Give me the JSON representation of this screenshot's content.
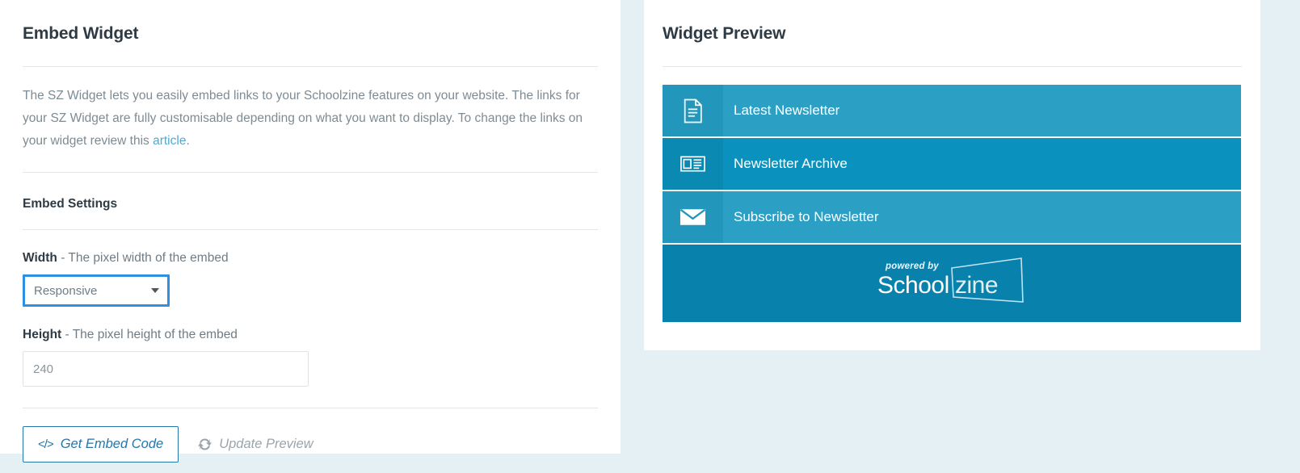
{
  "colors": {
    "page_background": "#e4f0f3",
    "card_background": "#ffffff",
    "heading": "#2f3b44",
    "body_text": "#7e8b93",
    "link": "#54a8ce",
    "focus_ring": "#2f8fe0",
    "button_outline": "#2576a8",
    "widget_row_light": "#2ba0c4",
    "widget_row_dark": "#0b91bd",
    "widget_footer": "#0881ad"
  },
  "left_panel": {
    "title": "Embed Widget",
    "description_part1": "The SZ Widget lets you easily embed links to your Schoolzine features on your website. The links for your SZ Widget are fully customisable depending on what you want to display. To change the links on your widget review this ",
    "description_link": "article",
    "description_part2": ".",
    "settings_title": "Embed Settings",
    "width_label_bold": "Width",
    "width_label_rest": " - The pixel width of the embed",
    "width_value": "Responsive",
    "width_options": [
      "Responsive"
    ],
    "height_label_bold": "Height",
    "height_label_rest": " - The pixel height of the embed",
    "height_value": "240",
    "get_embed_code_label": "Get Embed Code",
    "get_embed_code_icon": "code-icon",
    "update_preview_label": "Update Preview",
    "update_preview_icon": "refresh-icon"
  },
  "right_panel": {
    "title": "Widget Preview",
    "widget_rows": [
      {
        "label": "Latest Newsletter",
        "icon": "document-icon",
        "shade": "light"
      },
      {
        "label": "Newsletter Archive",
        "icon": "newspaper-icon",
        "shade": "dark"
      },
      {
        "label": "Subscribe to Newsletter",
        "icon": "envelope-icon",
        "shade": "light"
      }
    ],
    "footer_logo": {
      "powered_by": "powered by",
      "brand_first": "School",
      "brand_second": "zine"
    }
  }
}
